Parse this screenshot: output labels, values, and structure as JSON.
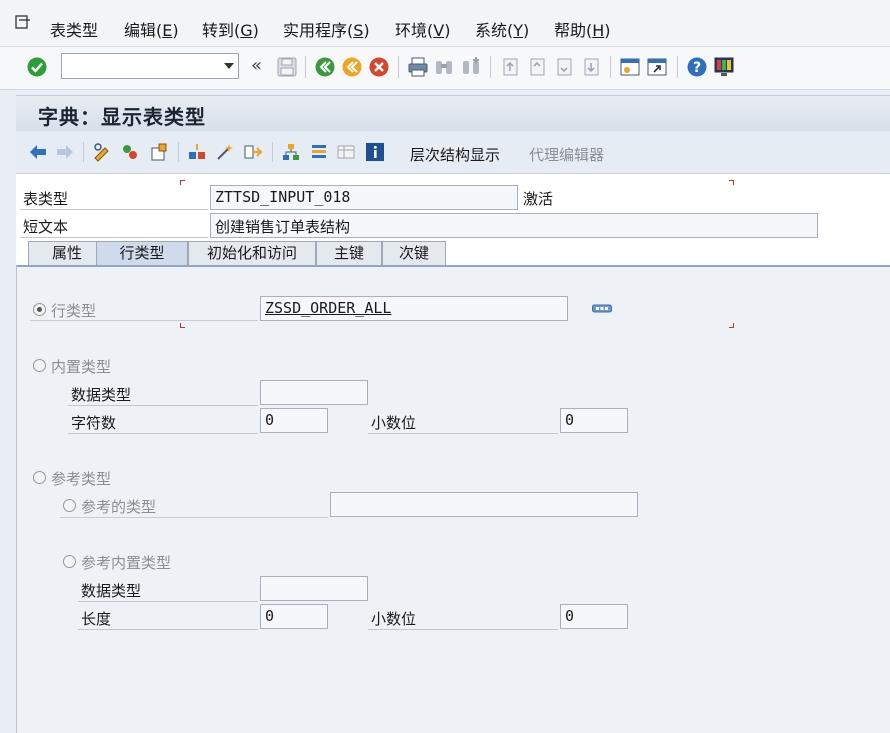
{
  "menubar": {
    "items": [
      {
        "label": "表类型",
        "hotkey": ""
      },
      {
        "label": "编辑(",
        "hotkey": "E",
        "end": ")"
      },
      {
        "label": "转到(",
        "hotkey": "G",
        "end": ")"
      },
      {
        "label": "实用程序(",
        "hotkey": "S",
        "end": ")"
      },
      {
        "label": "环境(",
        "hotkey": "V",
        "end": ")"
      },
      {
        "label": "系统(",
        "hotkey": "Y",
        "end": ")"
      },
      {
        "label": "帮助(",
        "hotkey": "H",
        "end": ")"
      }
    ]
  },
  "toolbar": {
    "command_value": "",
    "back_glyph": "«"
  },
  "title": "字典：显示表类型",
  "apptoolbar": {
    "hierarchy_label": "层次结构显示",
    "proxy_label": "代理编辑器"
  },
  "header": {
    "table_type_label": "表类型",
    "table_type_value": "ZTTSD_INPUT_018",
    "status": "激活",
    "short_text_label": "短文本",
    "short_text_value": "创建销售订单表结构"
  },
  "tabs": [
    {
      "label": "属性",
      "active": false
    },
    {
      "label": "行类型",
      "active": true
    },
    {
      "label": "初始化和访问",
      "active": false
    },
    {
      "label": "主键",
      "active": false
    },
    {
      "label": "次键",
      "active": false
    }
  ],
  "panel": {
    "row_type_label": "行类型",
    "row_type_value": "ZSSD_ORDER_ALL",
    "builtin_type_label": "内置类型",
    "data_type_label": "数据类型",
    "data_type_value": "",
    "num_chars_label": "字符数",
    "num_chars_value": "0",
    "decimals_label": "小数位",
    "decimals_value": "0",
    "ref_type_label": "参考类型",
    "ref_of_type_label": "参考的类型",
    "ref_of_type_value": "",
    "ref_builtin_label": "参考内置类型",
    "ref_data_type_label": "数据类型",
    "ref_data_type_value": "",
    "length_label": "长度",
    "length_value": "0",
    "ref_decimals_label": "小数位",
    "ref_decimals_value": "0"
  },
  "colors": {
    "accent": "#8fa7c4",
    "ok_green": "#2e9e3a",
    "cancel_red": "#d9452b",
    "nav_blue": "#2f6fc0"
  }
}
